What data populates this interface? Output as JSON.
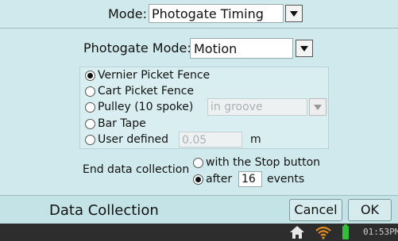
{
  "mode": {
    "label": "Mode:",
    "value": "Photogate Timing"
  },
  "photogate_mode": {
    "label": "Photogate Mode:",
    "value": "Motion"
  },
  "options": [
    {
      "label": "Vernier Picket Fence",
      "selected": true
    },
    {
      "label": "Cart Picket Fence",
      "selected": false
    },
    {
      "label": "Pulley (10 spoke)",
      "selected": false,
      "sub_value": "in groove"
    },
    {
      "label": "Bar Tape",
      "selected": false
    },
    {
      "label": "User defined",
      "selected": false,
      "sub_value": "0.05",
      "unit": "m"
    }
  ],
  "end_collection": {
    "label": "End data collection",
    "opt_stop": "with the Stop button",
    "opt_after": "after",
    "count": "16",
    "events": "events"
  },
  "bottom_bar": {
    "title": "Data Collection",
    "cancel": "Cancel",
    "ok": "OK"
  },
  "status_bar": {
    "time": "01:53PM"
  },
  "colors": {
    "wifi": "#e08a1e",
    "battery": "#2fbf3a",
    "home": "#e8e8e8"
  }
}
